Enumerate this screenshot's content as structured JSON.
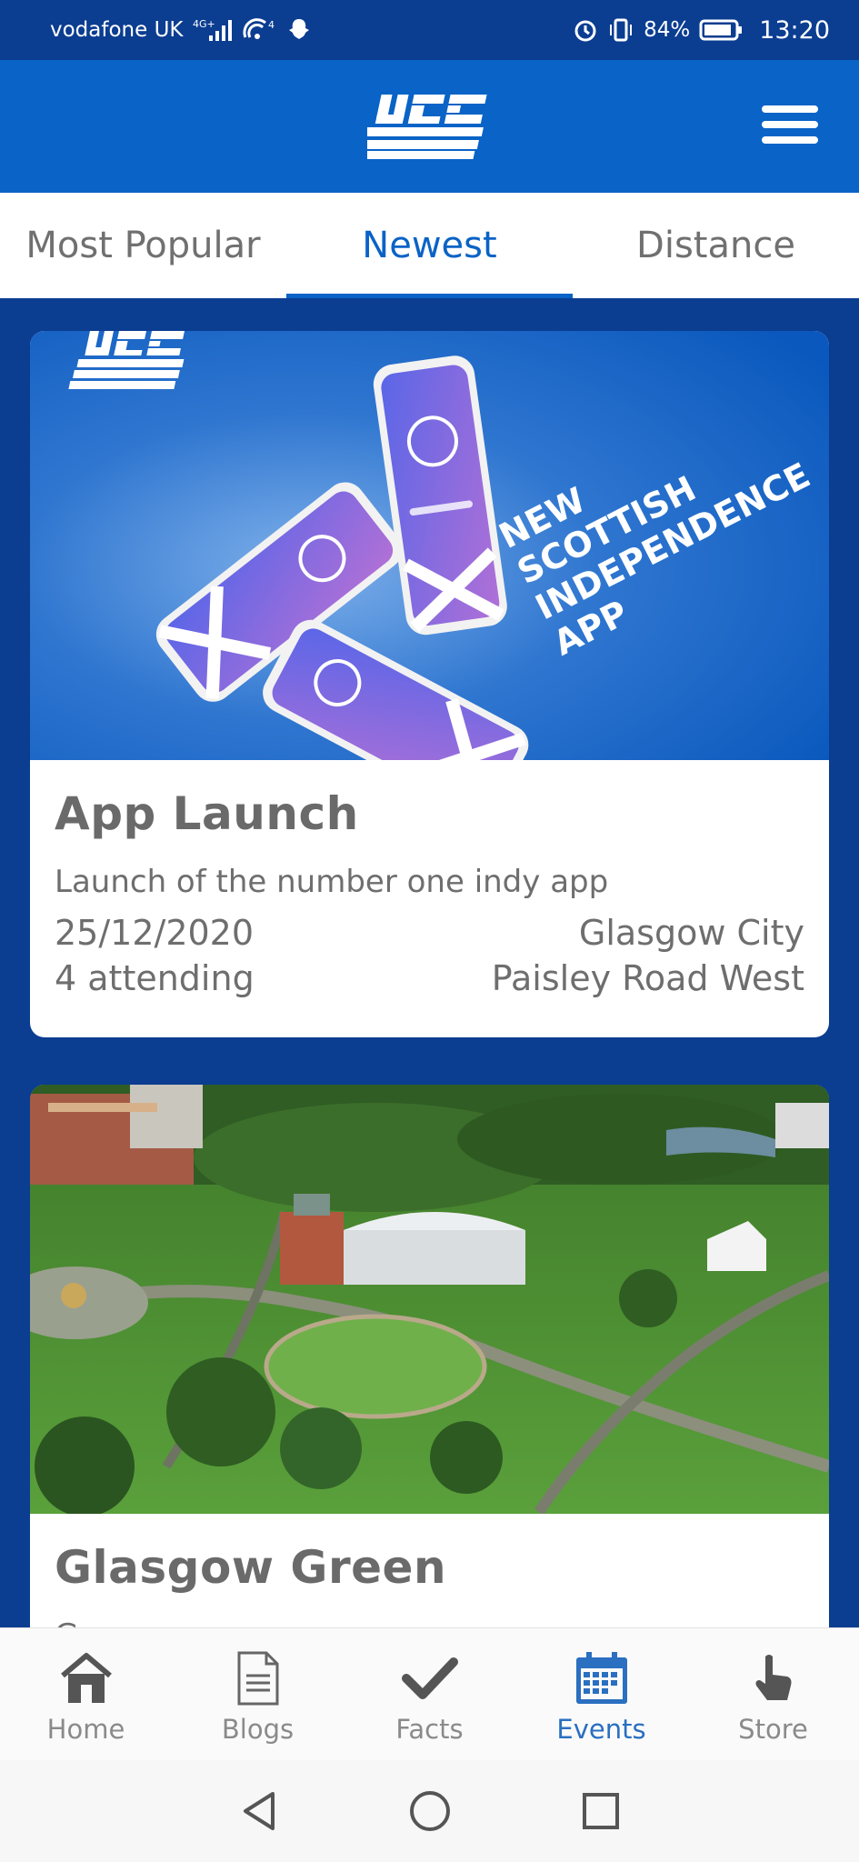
{
  "status_bar": {
    "carrier": "vodafone UK",
    "network": "4G+",
    "hotspot_badge": "4",
    "battery": "84%",
    "time": "13:20"
  },
  "header": {
    "logo_icon": "yes-logo",
    "menu_icon": "hamburger-icon"
  },
  "tabs": [
    {
      "label": "Most Popular",
      "active": false
    },
    {
      "label": "Newest",
      "active": true
    },
    {
      "label": "Distance",
      "active": false
    }
  ],
  "events": [
    {
      "image_text": [
        "NEW",
        "SCOTTISH",
        "INDEPENDENCE",
        "APP"
      ],
      "title": "App Launch",
      "description": "Launch of the number one indy app",
      "date": "25/12/2020",
      "attending": "4 attending",
      "city": "Glasgow City",
      "street": "Paisley Road West"
    },
    {
      "title": "Glasgow Green",
      "description": "G..."
    }
  ],
  "bottom_nav": [
    {
      "label": "Home",
      "icon": "home-icon",
      "active": false
    },
    {
      "label": "Blogs",
      "icon": "document-icon",
      "active": false
    },
    {
      "label": "Facts",
      "icon": "check-icon",
      "active": false
    },
    {
      "label": "Events",
      "icon": "calendar-icon",
      "active": true
    },
    {
      "label": "Store",
      "icon": "hand-pointer-icon",
      "active": false
    }
  ],
  "colors": {
    "header_blue": "#0a63c6",
    "page_navy": "#0b3d91",
    "active_blue": "#2a6fc0",
    "text_grey": "#6e6e6e"
  }
}
